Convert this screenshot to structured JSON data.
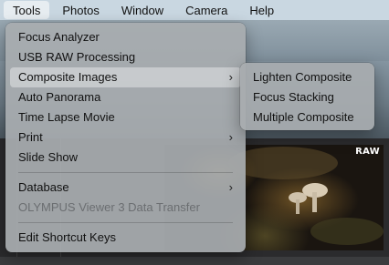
{
  "menubar": {
    "items": [
      {
        "label": "Tools"
      },
      {
        "label": "Photos"
      },
      {
        "label": "Window"
      },
      {
        "label": "Camera"
      },
      {
        "label": "Help"
      }
    ]
  },
  "tools_menu": {
    "items": [
      {
        "label": "Focus Analyzer"
      },
      {
        "label": "USB RAW Processing"
      },
      {
        "label": "Composite Images",
        "submenu_arrow": "›"
      },
      {
        "label": "Auto Panorama"
      },
      {
        "label": "Time Lapse Movie"
      },
      {
        "label": "Print",
        "submenu_arrow": "›"
      },
      {
        "label": "Slide Show"
      },
      {
        "label": "Database",
        "submenu_arrow": "›"
      },
      {
        "label": "OLYMPUS Viewer 3 Data Transfer"
      },
      {
        "label": "Edit Shortcut Keys"
      }
    ]
  },
  "composite_submenu": {
    "items": [
      {
        "label": "Lighten Composite"
      },
      {
        "label": "Focus Stacking"
      },
      {
        "label": "Multiple Composite"
      }
    ]
  },
  "photo": {
    "badge": "RAW"
  },
  "colors": {
    "menubar_bg": "#c9d7e1",
    "menu_bg": "#a8acaf",
    "highlight": "#d6d8da",
    "disabled_text": "#6b6e71"
  }
}
